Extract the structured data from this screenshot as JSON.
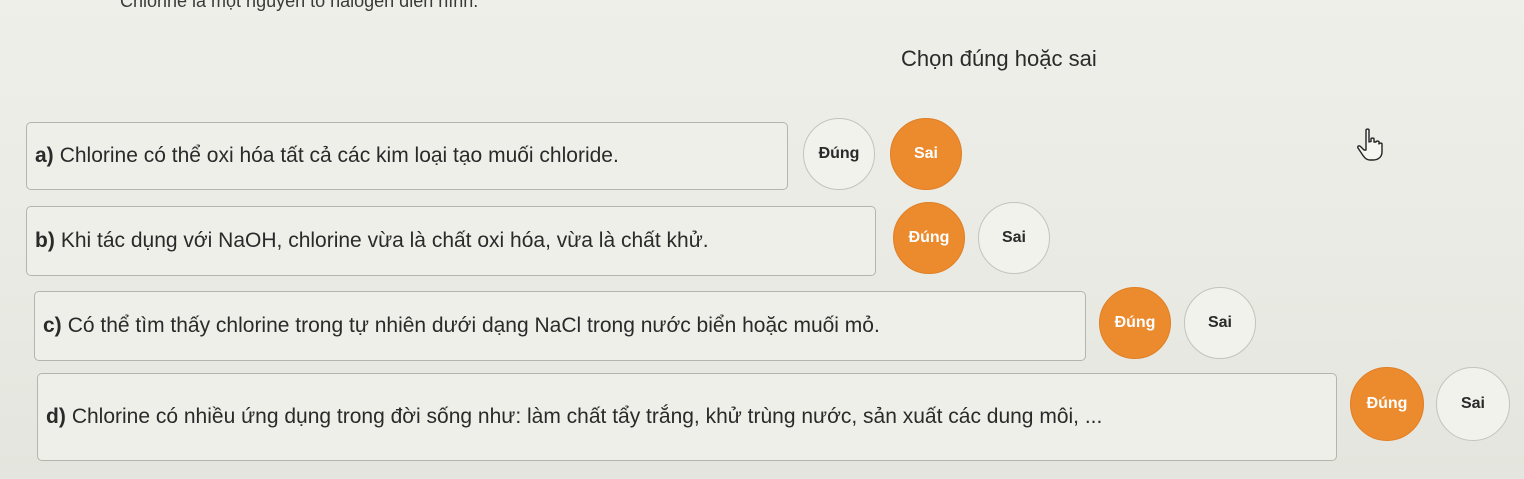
{
  "header_text": "Chlorine là một nguyên tố halogen điển hình.",
  "instruction": "Chọn đúng hoặc sai",
  "statements": [
    {
      "label": "a)",
      "text": "Chlorine có thể oxi hóa tất cả các kim loại tạo muối chloride.",
      "true_label": "Đúng",
      "false_label": "Sai",
      "selected": "Sai"
    },
    {
      "label": "b)",
      "text": "Khi tác dụng với NaOH, chlorine vừa là chất oxi hóa, vừa là chất khử.",
      "true_label": "Đúng",
      "false_label": "Sai",
      "selected": "Đúng"
    },
    {
      "label": "c)",
      "text": "Có thể tìm thấy chlorine trong tự nhiên dưới dạng NaCl trong nước biển hoặc muối mỏ.",
      "true_label": "Đúng",
      "false_label": "Sai",
      "selected": "Đúng"
    },
    {
      "label": "d)",
      "text": "Chlorine có nhiều ứng dụng trong đời sống như: làm chất tẩy trắng, khử trùng nước, sản xuất các dung môi, ...",
      "true_label": "Đúng",
      "false_label": "Sai",
      "selected": "Đúng"
    }
  ],
  "colors": {
    "selected": "#ec8a2e",
    "unselected": "#f1f2ec",
    "background": "#eeefe9"
  },
  "icons": {
    "cursor": "hand-pointer-icon"
  }
}
